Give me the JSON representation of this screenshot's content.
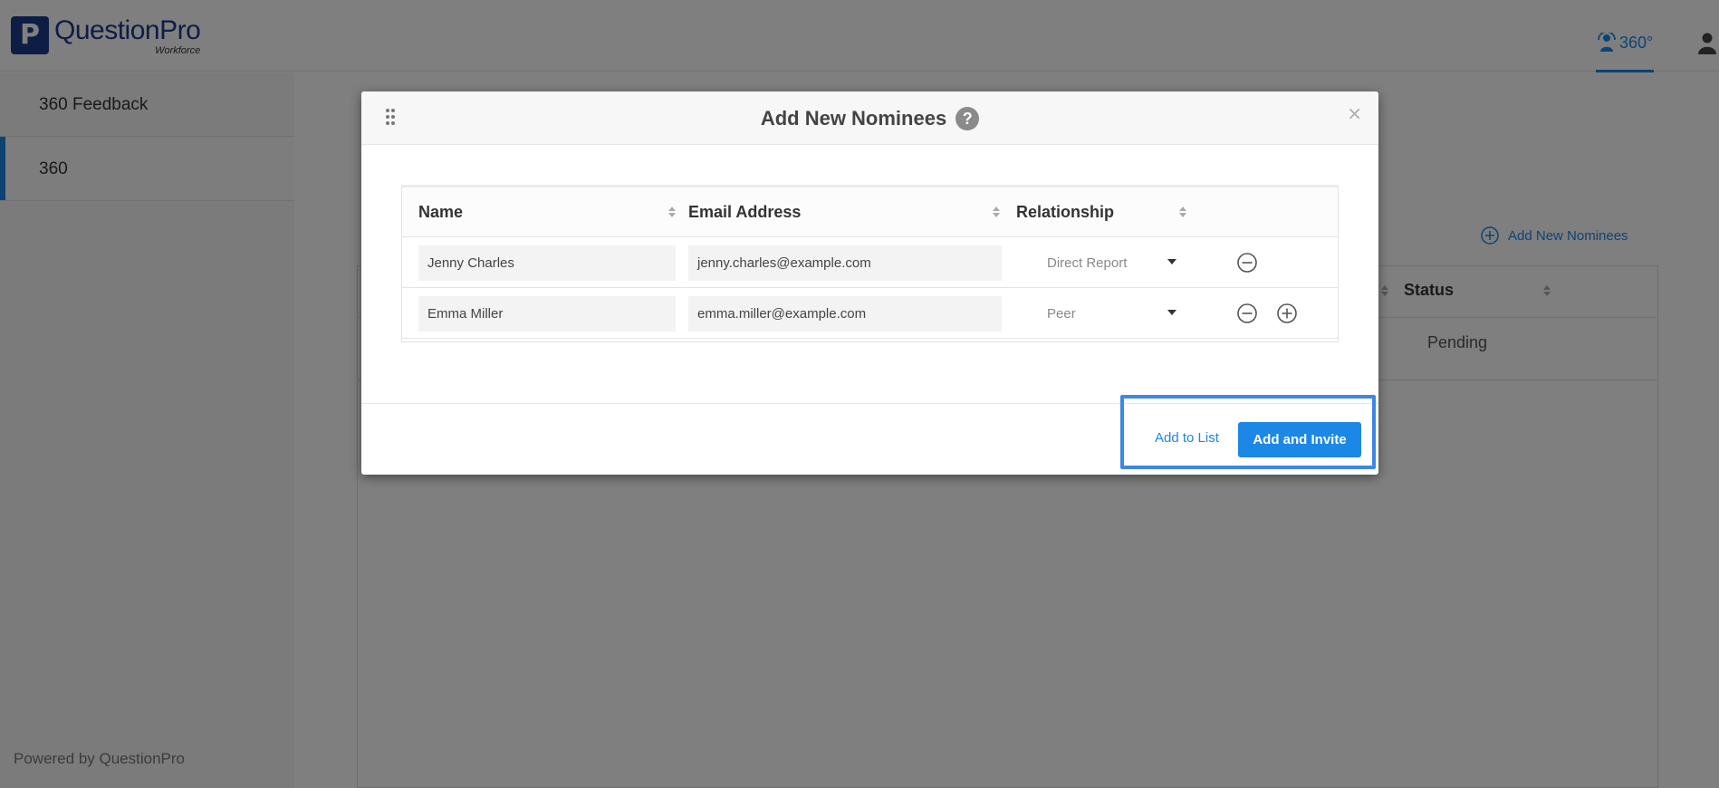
{
  "header": {
    "logo_letter": "P",
    "logo_name": "QuestionPro",
    "logo_sub": "Workforce",
    "nav_360_label": "360°",
    "accent_color": "#1b87e6",
    "brand_color": "#1b3a8c"
  },
  "sidebar": {
    "items": [
      {
        "label": "360 Feedback"
      },
      {
        "label": "360"
      }
    ],
    "powered_by": "Powered by QuestionPro"
  },
  "background": {
    "add_new_nominees_link": "Add New Nominees",
    "status_header": "Status",
    "status_value": "Pending"
  },
  "modal": {
    "title": "Add New Nominees",
    "help_icon": "?",
    "close_icon": "×",
    "columns": [
      "Name",
      "Email Address",
      "Relationship"
    ],
    "rows": [
      {
        "name": "Jenny Charles",
        "email": "jenny.charles@example.com",
        "relationship": "Direct Report"
      },
      {
        "name": "Emma Miller",
        "email": "emma.miller@example.com",
        "relationship": "Peer"
      }
    ],
    "footer": {
      "add_to_list": "Add to List",
      "add_and_invite": "Add and Invite"
    }
  }
}
